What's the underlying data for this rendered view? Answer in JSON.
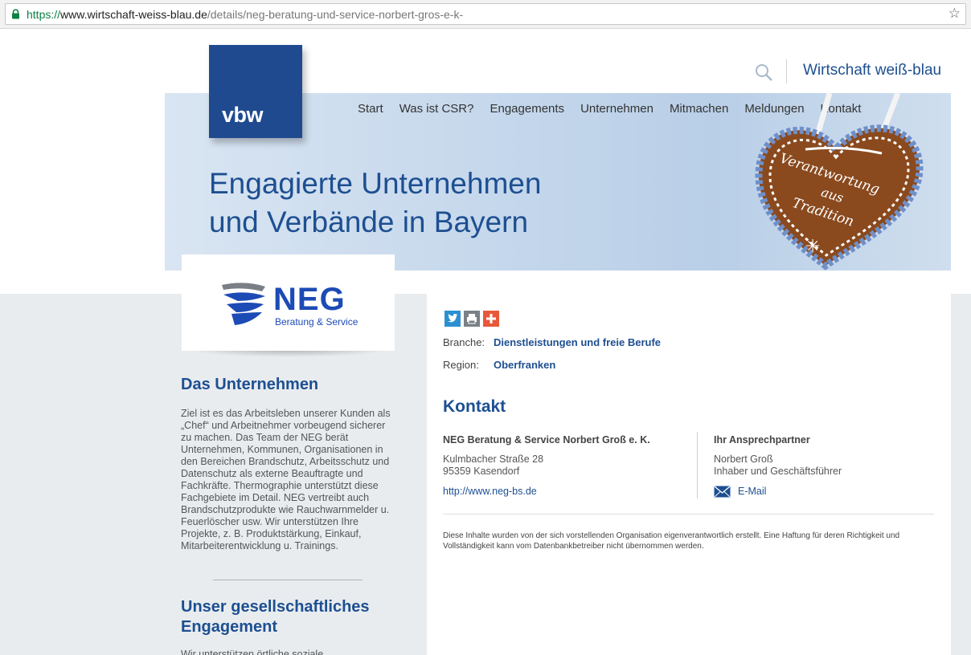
{
  "browser": {
    "url_protocol": "https://",
    "url_host": "www.wirtschaft-weiss-blau.de",
    "url_path": "/details/neg-beratung-und-service-norbert-gros-e-k-"
  },
  "header": {
    "site_name": "Wirtschaft weiß-blau",
    "logo_text": "vbw",
    "nav": [
      "Start",
      "Was ist CSR?",
      "Engagements",
      "Unternehmen",
      "Mitmachen",
      "Meldungen",
      "Kontakt"
    ],
    "headline_line1": "Engagierte Unternehmen",
    "headline_line2": "und Verbände in Bayern",
    "heart_text": [
      "Verantwortung",
      "aus",
      "Tradition"
    ]
  },
  "company_logo": {
    "name": "NEG",
    "subtitle": "Beratung & Service"
  },
  "left": {
    "heading1": "Das Unternehmen",
    "about_text": "Ziel ist es das Arbeitsleben unserer Kunden als „Chef“ und Arbeitnehmer vorbeugend sicherer zu machen. Das Team der NEG berät Unternehmen, Kommunen, Organisationen in den Bereichen Brandschutz, Arbeitsschutz und Datenschutz als externe Beauftragte und Fachkräfte. Thermographie unterstützt diese Fachgebiete im Detail. NEG vertreibt auch Brandschutzprodukte wie Rauchwarnmelder u. Feuerlöscher usw. Wir unterstützen Ihre Projekte, z. B. Produktstärkung, Einkauf, Mitarbeiterentwicklung u. Trainings.",
    "heading2_line1": "Unser gesellschaftliches",
    "heading2_line2": "Engagement",
    "engagement_text": "Wir unterstützen örtliche soziale"
  },
  "details": {
    "share_icons": [
      "twitter-icon",
      "print-icon",
      "plus-icon"
    ],
    "branche_label": "Branche:",
    "branche_value": "Dienstleistungen und freie Berufe",
    "region_label": "Region:",
    "region_value": "Oberfranken"
  },
  "kontakt": {
    "heading": "Kontakt",
    "company": "NEG Beratung & Service Norbert Groß e. K.",
    "street": "Kulmbacher Straße 28",
    "city": "95359 Kasendorf",
    "website": "http://www.neg-bs.de",
    "contact_heading": "Ihr Ansprechpartner",
    "contact_name": "Norbert Groß",
    "contact_role": "Inhaber und Geschäftsführer",
    "email_label": "E-Mail"
  },
  "disclaimer": "Diese Inhalte wurden von der sich vorstellenden Organisation eigenverantwortlich erstellt. Eine Haftung für deren Richtigkeit und Vollständigkeit kann vom Datenbankbetreiber nicht übernommen werden.",
  "colors": {
    "brand_blue": "#1d4f91",
    "logo_blue": "#1f4a8f",
    "neg_blue": "#1d4bb5",
    "twitter": "#2b8fd1",
    "print": "#7a8086",
    "plus": "#e8583a"
  }
}
